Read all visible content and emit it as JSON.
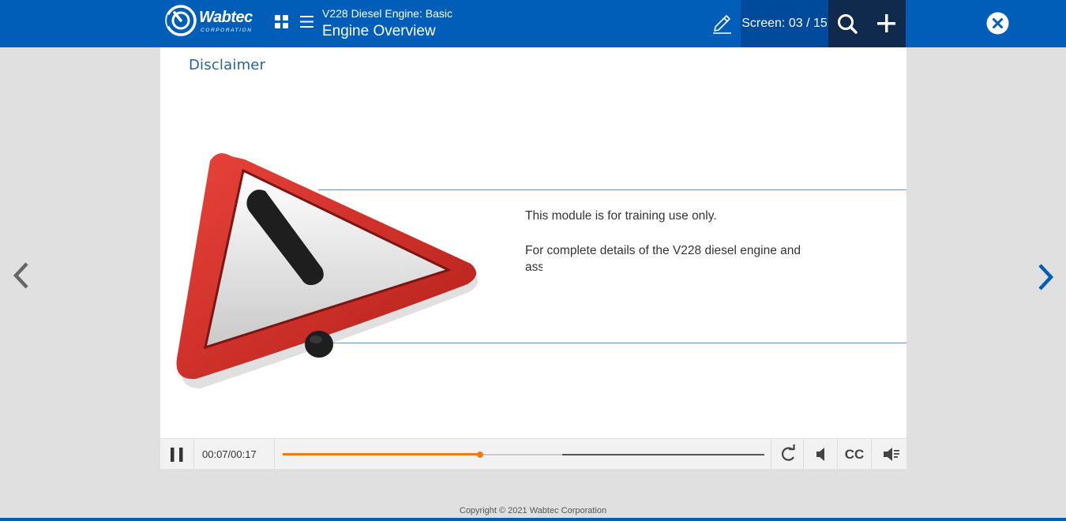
{
  "header": {
    "logo_text": "Wabtec",
    "logo_subtext": "CORPORATION",
    "course_title": "V228 Diesel Engine: Basic",
    "screen_title": "Engine Overview",
    "screen_counter": "Screen: 03 / 15",
    "icons": [
      "grid-icon",
      "menu-icon",
      "pencil-icon",
      "search-icon",
      "plus-icon",
      "close-icon"
    ],
    "accent_color": "#005eb8"
  },
  "slide": {
    "heading": "Disclaimer",
    "disclaimer_line1": "This module is for training use only.",
    "disclaimer_line2a": "For complete details of the V228 diesel engine and",
    "disclaimer_line2b": "associated"
  },
  "player": {
    "current_time": "00:07",
    "total_time": "00:17",
    "time_separator": "/",
    "progress_fraction": 0.41,
    "buffered_fraction": 0.58,
    "cc_label": "CC",
    "progress_color": "#f07b13"
  },
  "footer": {
    "copyright": "Copyright © 2021 Wabtec Corporation"
  }
}
